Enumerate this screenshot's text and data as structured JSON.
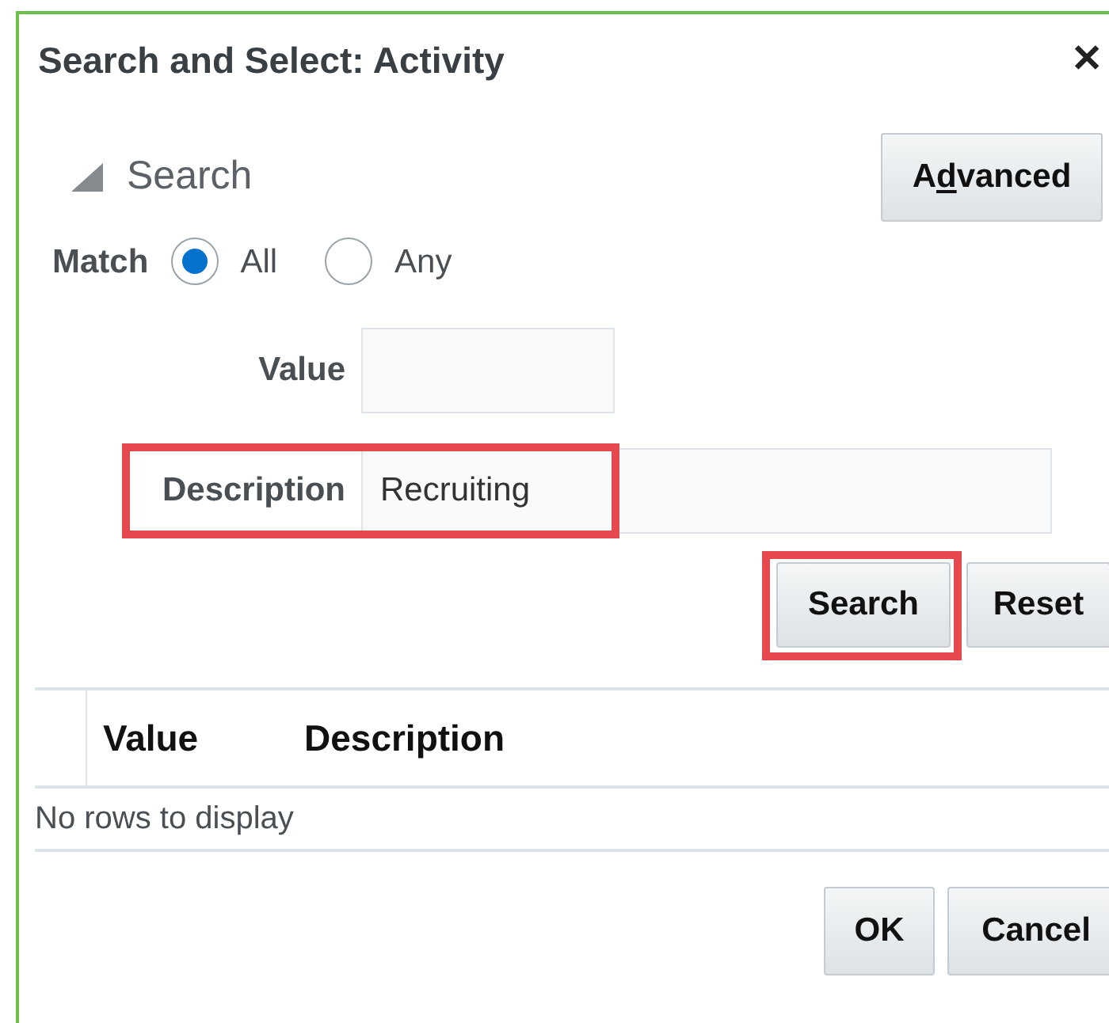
{
  "dialog": {
    "title": "Search and Select: Activity",
    "close": "✕"
  },
  "search_panel": {
    "label": "Search",
    "expanded": true,
    "advanced_button": {
      "label_parts": [
        "A",
        "d",
        "vanced"
      ]
    }
  },
  "match": {
    "label": "Match",
    "options": [
      {
        "label": "All",
        "selected": true
      },
      {
        "label": "Any",
        "selected": false
      }
    ]
  },
  "fields": [
    {
      "label": "Value",
      "kind": "short",
      "highlighted": false
    },
    {
      "label": "Description",
      "value": "Recruiting",
      "kind": "long",
      "highlighted": true
    }
  ],
  "actions": [
    {
      "label": "Search",
      "highlighted": true
    },
    {
      "label": "Reset",
      "highlighted": false
    }
  ],
  "table": {
    "columns": [
      "Value",
      "Description"
    ],
    "empty_message": "No rows to display"
  },
  "buttons": [
    "OK",
    "Cancel"
  ]
}
